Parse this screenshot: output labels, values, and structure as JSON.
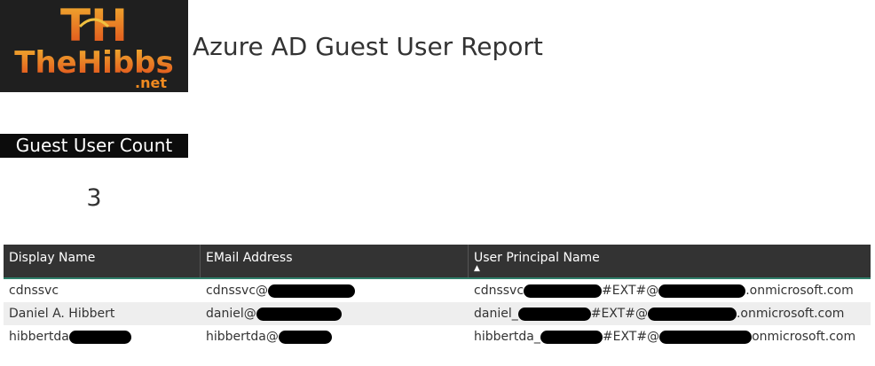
{
  "logo": {
    "monogram": "TH",
    "wordmark": "TheHibbs",
    "tld": ".net"
  },
  "report": {
    "title": "Azure AD Guest User Report"
  },
  "card": {
    "label": "Guest User Count",
    "value": "3"
  },
  "table": {
    "columns": [
      "Display Name",
      "EMail Address",
      "User Principal Name"
    ],
    "sort_column": "User Principal Name",
    "rows": [
      {
        "display_name": "cdnssvc",
        "email_prefix": "cdnssvc@",
        "upn_prefix": "cdnssvc",
        "upn_middle": "#EXT#@",
        "upn_suffix": ".onmicrosoft.com"
      },
      {
        "display_name": "Daniel A. Hibbert",
        "email_prefix": "daniel@",
        "upn_prefix": "daniel_",
        "upn_middle": "#EXT#@",
        "upn_suffix": ".onmicrosoft.com"
      },
      {
        "display_name": "hibbertda",
        "email_prefix": "hibbertda@",
        "upn_prefix": "hibbertda_",
        "upn_middle": "#EXT#@",
        "upn_suffix": "onmicrosoft.com"
      }
    ]
  }
}
